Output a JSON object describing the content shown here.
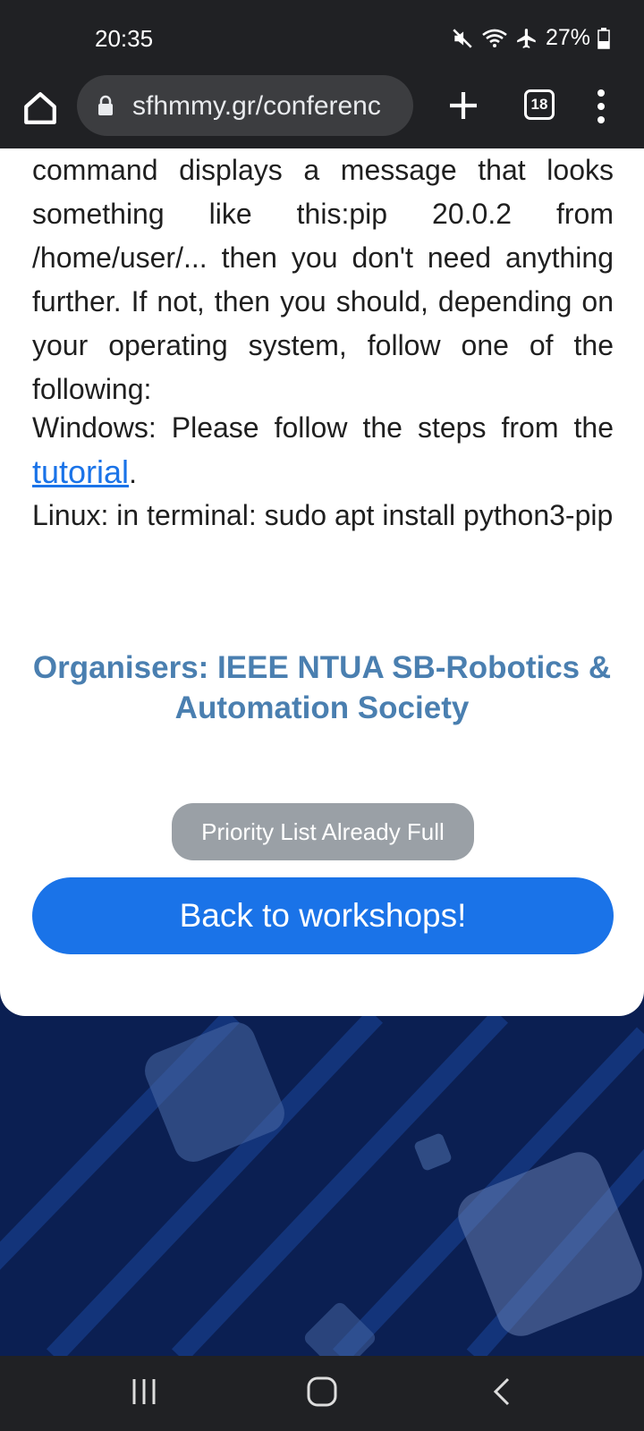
{
  "status_bar": {
    "time": "20:35",
    "battery": "27%"
  },
  "browser": {
    "url": "sfhmmy.gr/conferenc",
    "tab_count": "18"
  },
  "content": {
    "paragraph_1": "command displays a message that looks something like this:pip 20.0.2 from /home/user/... then you don't need anything further. If not, then you should, depending on your operating system, follow one of the following:",
    "windows_text": "Windows: Please follow the steps from the",
    "tutorial_link": "tutorial",
    "windows_end": ".",
    "linux_text": "Linux: in terminal: sudo apt install python3-pip",
    "organisers": "Organisers: IEEE NTUA SB-Robotics & Automation Society",
    "priority_button": "Priority List Already Full",
    "back_button": "Back to workshops!"
  },
  "icons": [
    "mute-icon",
    "wifi-icon",
    "airplane-icon",
    "battery-icon",
    "home-icon",
    "lock-icon",
    "plus-icon",
    "tabs-icon",
    "menu-icon",
    "recents-icon",
    "home-nav-icon",
    "back-icon"
  ]
}
